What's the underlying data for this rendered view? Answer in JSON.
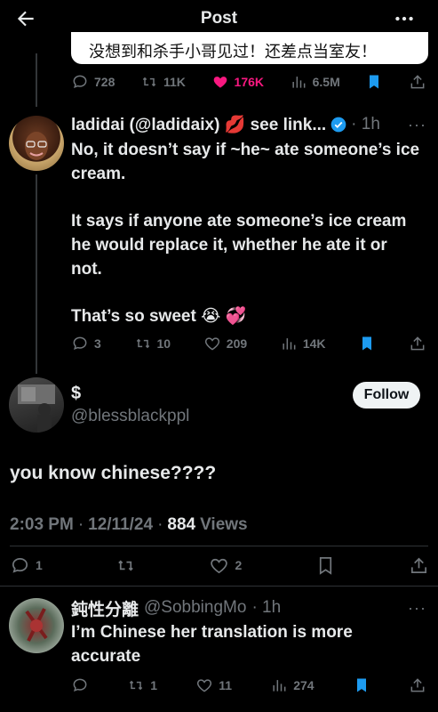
{
  "header": {
    "title": "Post"
  },
  "quoted_text": "没想到和杀手小哥见过！还差点当室友！",
  "post1_stats": {
    "replies": "728",
    "reposts": "11K",
    "likes": "176K",
    "views": "6.5M"
  },
  "reply1": {
    "author_display": "ladidai (@ladidaix) 💋 see link...",
    "time": "· 1h",
    "para1": "No, it doesn’t say if ~he~ ate someone’s ice cream.",
    "para2": "It says if anyone ate someone’s ice cream he would replace it, whether he ate it or not.",
    "para3": "That’s so sweet 😭 💞",
    "stats": {
      "replies": "3",
      "reposts": "10",
      "likes": "209",
      "views": "14K"
    }
  },
  "main": {
    "name": "$",
    "handle": "@blessblackppl",
    "follow_label": "Follow",
    "text": "you know chinese????",
    "time": "2:03 PM",
    "date": "12/11/24",
    "views_count": "884",
    "views_label": "Views",
    "stats": {
      "replies": "1",
      "likes": "2"
    }
  },
  "reply2": {
    "name": "鈍性分離",
    "handle": "@SobbingMo",
    "time": "· 1h",
    "text": "I’m Chinese her translation is more accurate",
    "stats": {
      "reposts": "1",
      "likes": "11",
      "views": "274"
    }
  },
  "colors": {
    "accent": "#1d9bf0",
    "like": "#f91880",
    "bg": "#000000",
    "text": "#e7e9ea",
    "muted": "#71767b"
  }
}
